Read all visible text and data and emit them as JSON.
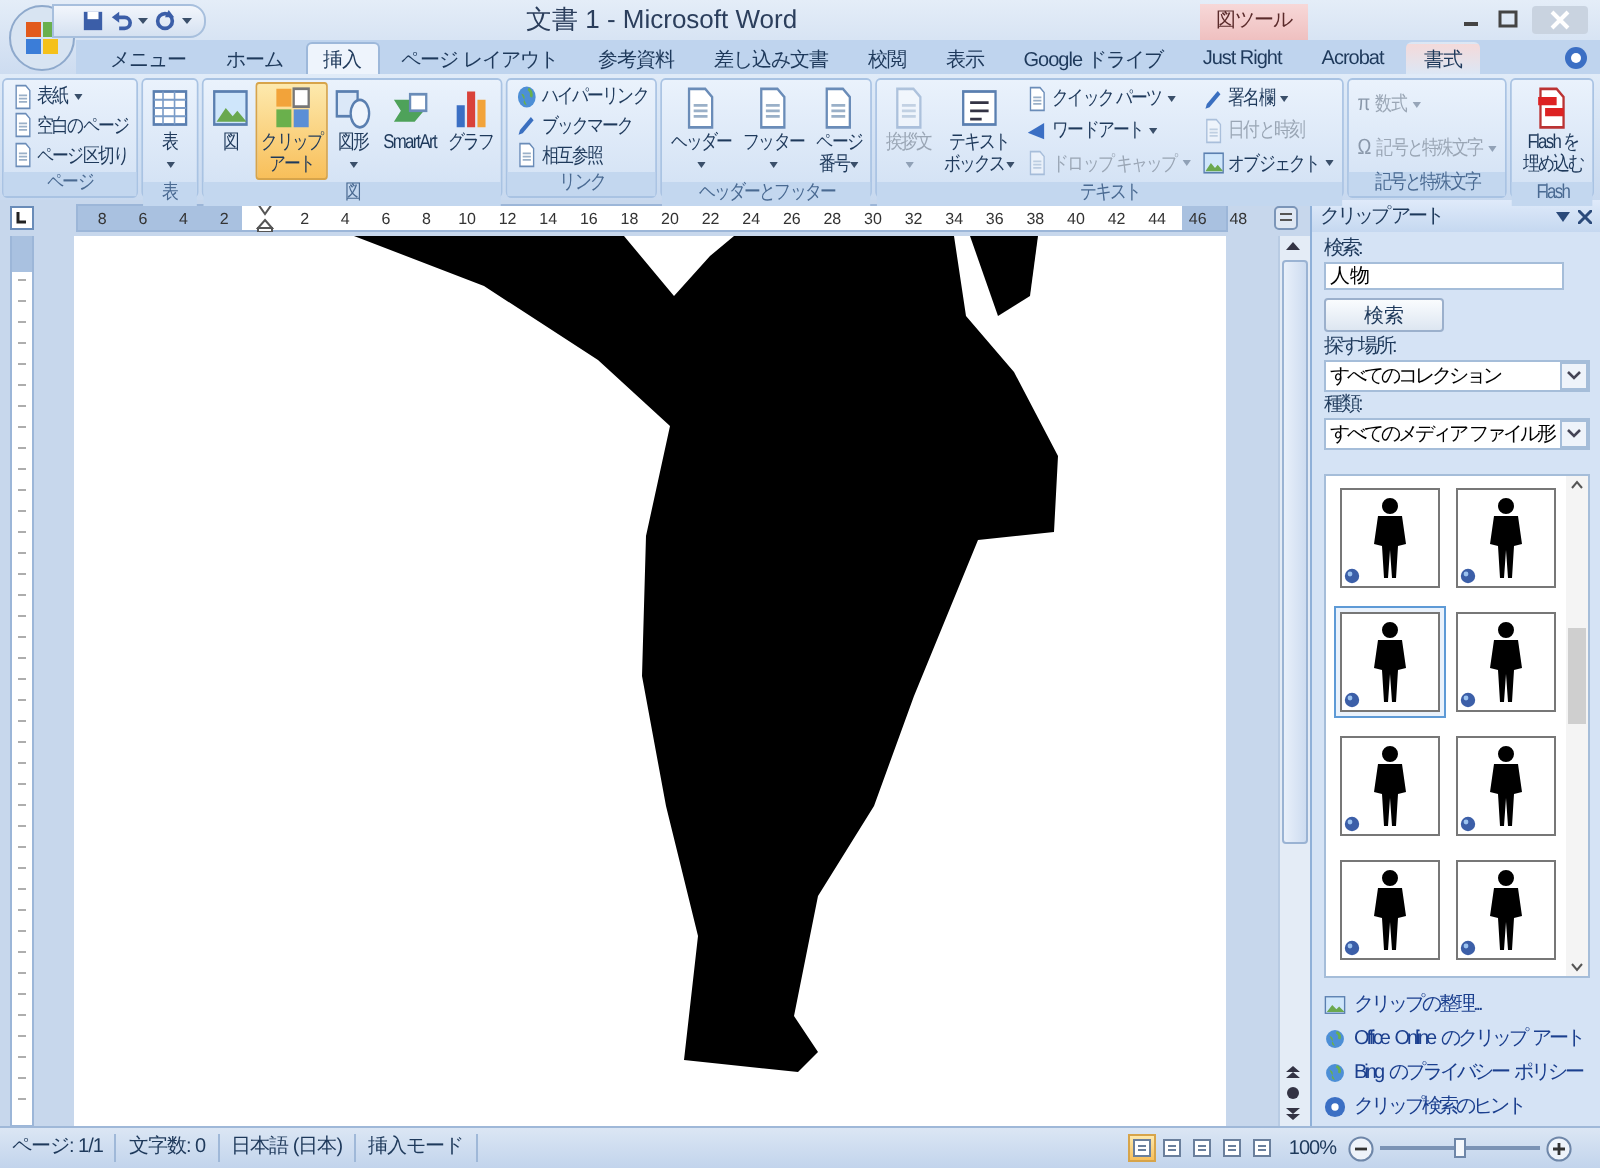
{
  "window": {
    "title": "文書 1 - Microsoft Word",
    "contextual_label": "図ツール"
  },
  "tabs": [
    {
      "label": "メニュー",
      "selected": false,
      "kind": "normal"
    },
    {
      "label": "ホーム",
      "selected": false,
      "kind": "normal"
    },
    {
      "label": "挿入",
      "selected": true,
      "kind": "normal"
    },
    {
      "label": "ページ レイアウト",
      "selected": false,
      "kind": "normal"
    },
    {
      "label": "参考資料",
      "selected": false,
      "kind": "normal"
    },
    {
      "label": "差し込み文書",
      "selected": false,
      "kind": "normal"
    },
    {
      "label": "校閲",
      "selected": false,
      "kind": "normal"
    },
    {
      "label": "表示",
      "selected": false,
      "kind": "normal"
    },
    {
      "label": "Google ドライブ",
      "selected": false,
      "kind": "normal"
    },
    {
      "label": "Just Right",
      "selected": false,
      "kind": "normal"
    },
    {
      "label": "Acrobat",
      "selected": false,
      "kind": "normal"
    },
    {
      "label": "書式",
      "selected": false,
      "kind": "contextual"
    }
  ],
  "ribbon": {
    "groups": [
      {
        "label": "ページ",
        "items": [
          {
            "label": "表紙",
            "kind": "small",
            "dropdown": true,
            "disabled": false,
            "selected": false
          },
          {
            "label": "空白のページ",
            "kind": "small",
            "dropdown": false,
            "disabled": false,
            "selected": false
          },
          {
            "label": "ページ区切り",
            "kind": "small",
            "dropdown": false,
            "disabled": false,
            "selected": false
          }
        ]
      },
      {
        "label": "表",
        "items": [
          {
            "label": "表",
            "kind": "large",
            "dropdown": true,
            "disabled": false,
            "selected": false
          }
        ]
      },
      {
        "label": "図",
        "items": [
          {
            "label": "図",
            "kind": "large",
            "dropdown": false,
            "disabled": false,
            "selected": false
          },
          {
            "label": "クリップアート",
            "kind": "large",
            "dropdown": false,
            "disabled": false,
            "selected": true
          },
          {
            "label": "図形",
            "kind": "large",
            "dropdown": true,
            "disabled": false,
            "selected": false
          },
          {
            "label": "SmartArt",
            "kind": "large",
            "dropdown": false,
            "disabled": false,
            "selected": false
          },
          {
            "label": "グラフ",
            "kind": "large",
            "dropdown": false,
            "disabled": false,
            "selected": false
          }
        ]
      },
      {
        "label": "リンク",
        "items": [
          {
            "label": "ハイパーリンク",
            "kind": "small",
            "dropdown": false,
            "disabled": false,
            "selected": false
          },
          {
            "label": "ブックマーク",
            "kind": "small",
            "dropdown": false,
            "disabled": false,
            "selected": false
          },
          {
            "label": "相互参照",
            "kind": "small",
            "dropdown": false,
            "disabled": false,
            "selected": false
          }
        ]
      },
      {
        "label": "ヘッダーとフッター",
        "items": [
          {
            "label": "ヘッダー",
            "kind": "large",
            "dropdown": true,
            "disabled": false,
            "selected": false
          },
          {
            "label": "フッター",
            "kind": "large",
            "dropdown": true,
            "disabled": false,
            "selected": false
          },
          {
            "label": "ページ番号",
            "kind": "large",
            "dropdown": true,
            "disabled": false,
            "selected": false
          }
        ]
      },
      {
        "label": "テキスト",
        "items": [
          {
            "label": "挨拶文",
            "kind": "large",
            "dropdown": true,
            "disabled": true,
            "selected": false
          },
          {
            "label": "テキストボックス",
            "kind": "large",
            "dropdown": true,
            "disabled": false,
            "selected": false
          },
          {
            "label": "クイック パーツ",
            "kind": "small",
            "dropdown": true,
            "disabled": false,
            "selected": false
          },
          {
            "label": "ワードアート",
            "kind": "small",
            "dropdown": true,
            "disabled": false,
            "selected": false
          },
          {
            "label": "ドロップ キャップ",
            "kind": "small",
            "dropdown": true,
            "disabled": true,
            "selected": false
          },
          {
            "label": "署名欄",
            "kind": "small",
            "dropdown": true,
            "disabled": false,
            "selected": false
          },
          {
            "label": "日付と時刻",
            "kind": "small",
            "dropdown": false,
            "disabled": true,
            "selected": false
          },
          {
            "label": "オブジェクト",
            "kind": "small",
            "dropdown": true,
            "disabled": false,
            "selected": false
          }
        ]
      },
      {
        "label": "記号と特殊文字",
        "items": [
          {
            "label": "数式",
            "icon_glyph": "π",
            "kind": "small",
            "dropdown": true,
            "disabled": true,
            "selected": false
          },
          {
            "label": "記号と特殊文字",
            "icon_glyph": "Ω",
            "kind": "small",
            "dropdown": true,
            "disabled": true,
            "selected": false
          }
        ]
      },
      {
        "label": "Flash",
        "items": [
          {
            "label": "Flash を埋め込む",
            "kind": "large",
            "dropdown": false,
            "disabled": false,
            "selected": false
          }
        ]
      }
    ]
  },
  "ruler": {
    "labels": [
      "8",
      "6",
      "4",
      "2",
      "2",
      "4",
      "6",
      "8",
      "10",
      "12",
      "14",
      "16",
      "18",
      "20",
      "22",
      "24",
      "26",
      "28",
      "30",
      "32",
      "34",
      "36",
      "38",
      "40",
      "42",
      "44",
      "46",
      "48"
    ]
  },
  "clip_art_pane": {
    "title": "クリップ アート",
    "search_label": "検索:",
    "search_value": "人物",
    "search_button": "検索",
    "location_label": "探す場所:",
    "location_value": "すべてのコレクション",
    "type_label": "種類:",
    "type_value": "すべてのメディア ファイル形",
    "results": [
      {
        "selected": false
      },
      {
        "selected": false
      },
      {
        "selected": true
      },
      {
        "selected": false
      },
      {
        "selected": false
      },
      {
        "selected": false
      },
      {
        "selected": false
      },
      {
        "selected": false
      }
    ],
    "links": [
      "クリップの整理...",
      "Office Online のクリップ アート",
      "Bing のプライバシー ポリシー",
      "クリップ検索のヒント"
    ]
  },
  "status_bar": {
    "items": [
      "ページ: 1/1",
      "文字数: 0",
      "日本語 (日本)",
      "挿入モード"
    ],
    "views": [
      {
        "selected": true
      },
      {
        "selected": false
      },
      {
        "selected": false
      },
      {
        "selected": false
      },
      {
        "selected": false
      }
    ],
    "zoom": "100%",
    "zoom_slider": {
      "level": 0.5
    }
  }
}
